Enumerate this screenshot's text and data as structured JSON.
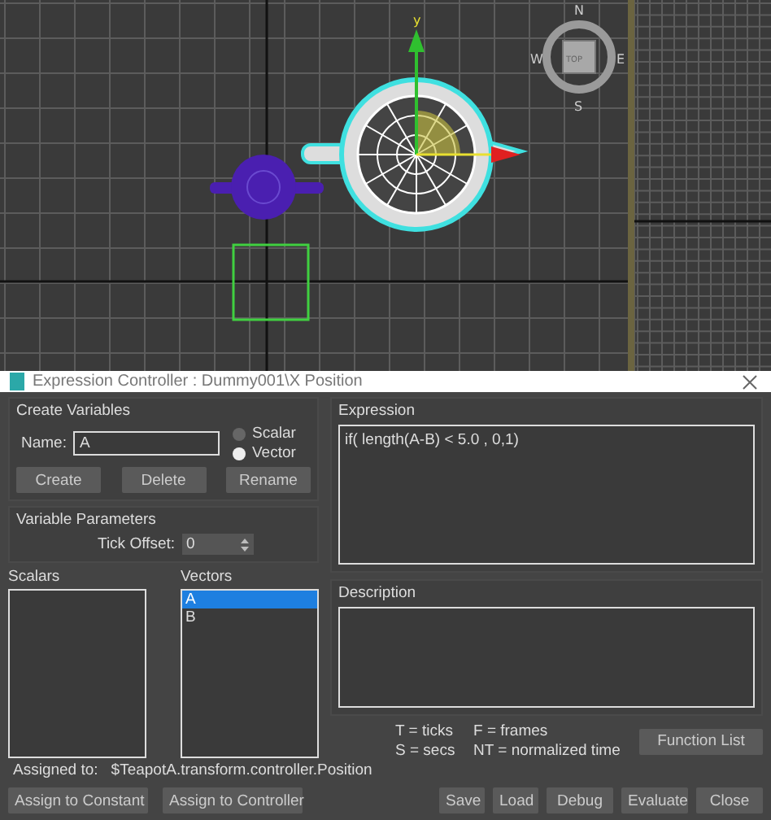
{
  "viewport": {
    "compass": {
      "north": "N",
      "west": "W",
      "east": "E",
      "south": "S",
      "cube_face": "TOP"
    },
    "gizmo_axis": "y"
  },
  "dialog": {
    "title": "Expression Controller : Dummy001\\X Position",
    "create_variables": {
      "title": "Create Variables",
      "name_label": "Name:",
      "name_value": "A",
      "types": [
        {
          "label": "Scalar",
          "selected": false
        },
        {
          "label": "Vector",
          "selected": true
        }
      ],
      "buttons": [
        "Create",
        "Delete",
        "Rename"
      ]
    },
    "variable_parameters": {
      "title": "Variable Parameters",
      "tick_offset_label": "Tick Offset:",
      "tick_offset_value": "0"
    },
    "scalars": {
      "title": "Scalars"
    },
    "vectors": {
      "title": "Vectors",
      "items": [
        {
          "label": "A",
          "selected": true
        },
        {
          "label": "B",
          "selected": false
        }
      ]
    },
    "expression": {
      "title": "Expression",
      "value": "if( length(A-B) < 5.0 , 0,1)"
    },
    "description": {
      "title": "Description"
    },
    "legend": [
      "T = ticks",
      "F = frames",
      "S = secs",
      "NT = normalized time"
    ],
    "function_list_button": "Function List",
    "assigned_label": "Assigned to:",
    "assigned_value": "$TeapotA.transform.controller.Position",
    "left_buttons": [
      "Assign to Constant",
      "Assign to Controller"
    ],
    "right_buttons": [
      "Save",
      "Load",
      "Debug",
      "Evaluate",
      "Close"
    ]
  }
}
